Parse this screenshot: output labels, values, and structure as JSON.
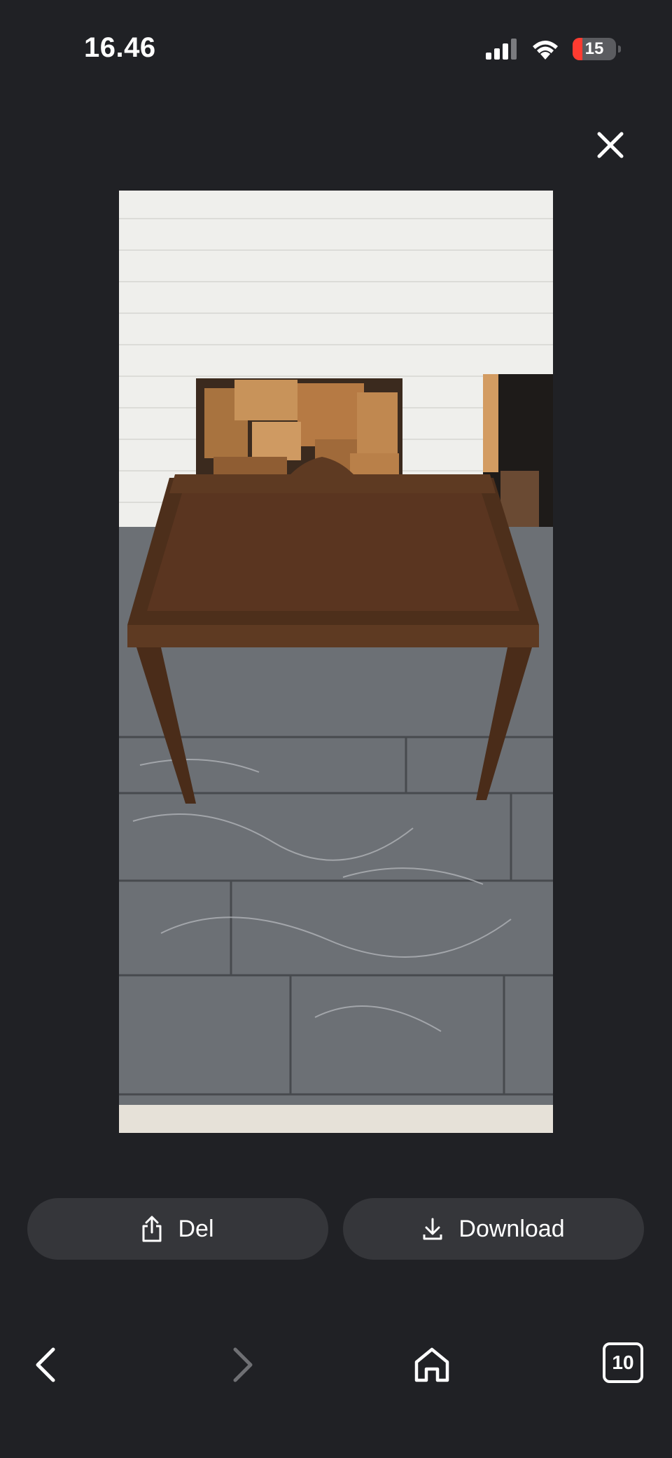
{
  "status_bar": {
    "time": "16.46",
    "battery_level": "15",
    "icons": [
      "cellular-signal-icon",
      "wifi-icon",
      "battery-icon"
    ]
  },
  "viewer": {
    "close_icon": "close-icon",
    "image_description_icon": "photo"
  },
  "actions": {
    "share_label": "Del",
    "share_icon": "share-icon",
    "download_label": "Download",
    "download_icon": "download-icon"
  },
  "bottom_nav": {
    "tab_count": "10",
    "items": [
      "back-icon",
      "forward-icon",
      "home-icon",
      "tabs-icon"
    ],
    "forward_enabled": false
  },
  "colors": {
    "background": "#202125",
    "button_bg": "#35363a",
    "battery_low": "#ff3b30"
  }
}
